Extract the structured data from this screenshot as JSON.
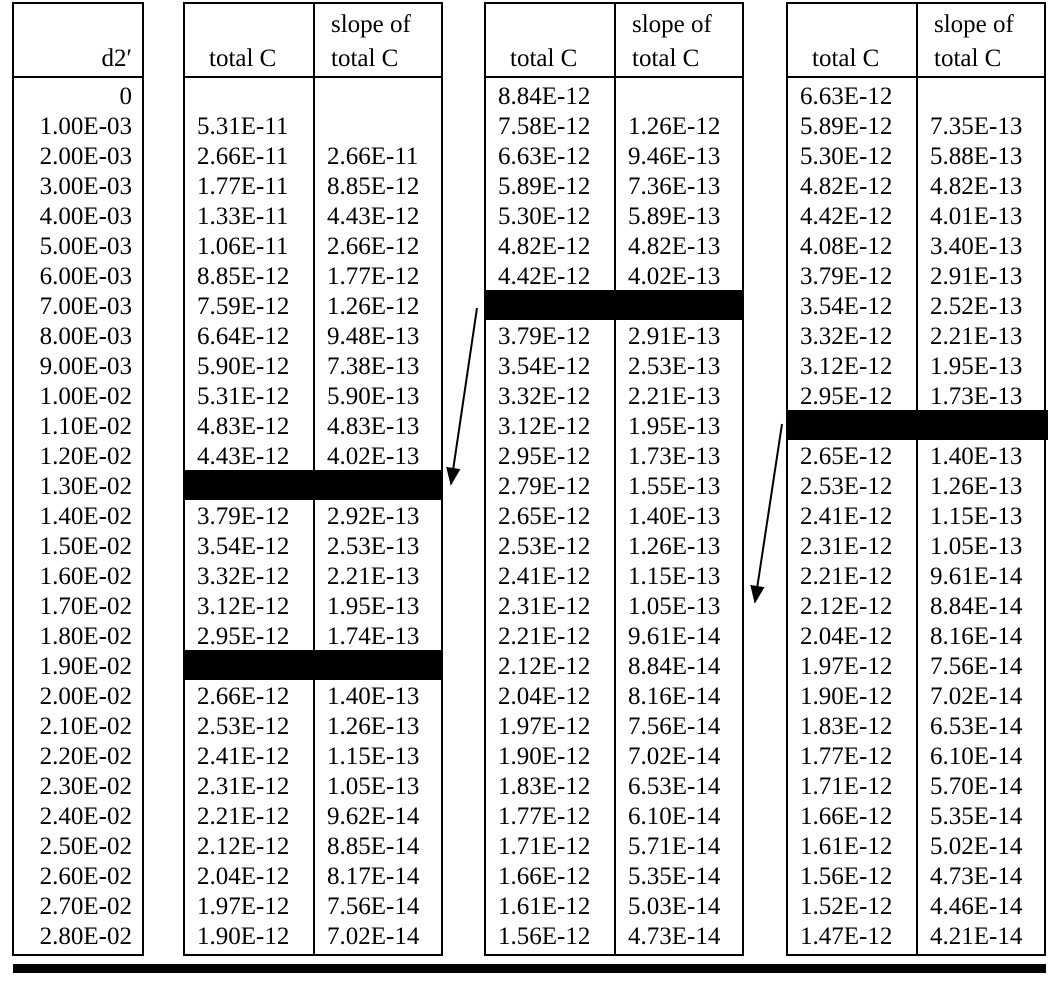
{
  "tables": [
    {
      "id": "d2",
      "headers": [
        {
          "line1": "",
          "line2": "d2′"
        }
      ],
      "rows": [
        [
          "0"
        ],
        [
          "1.00E-03"
        ],
        [
          "2.00E-03"
        ],
        [
          "3.00E-03"
        ],
        [
          "4.00E-03"
        ],
        [
          "5.00E-03"
        ],
        [
          "6.00E-03"
        ],
        [
          "7.00E-03"
        ],
        [
          "8.00E-03"
        ],
        [
          "9.00E-03"
        ],
        [
          "1.00E-02"
        ],
        [
          "1.10E-02"
        ],
        [
          "1.20E-02"
        ],
        [
          "1.30E-02"
        ],
        [
          "1.40E-02"
        ],
        [
          "1.50E-02"
        ],
        [
          "1.60E-02"
        ],
        [
          "1.70E-02"
        ],
        [
          "1.80E-02"
        ],
        [
          "1.90E-02"
        ],
        [
          "2.00E-02"
        ],
        [
          "2.10E-02"
        ],
        [
          "2.20E-02"
        ],
        [
          "2.30E-02"
        ],
        [
          "2.40E-02"
        ],
        [
          "2.50E-02"
        ],
        [
          "2.60E-02"
        ],
        [
          "2.70E-02"
        ],
        [
          "2.80E-02"
        ]
      ]
    },
    {
      "id": "set1",
      "headers": [
        {
          "line1": "",
          "line2": "total C"
        },
        {
          "line1": "slope of",
          "line2": "total C"
        }
      ],
      "rows": [
        [
          "",
          ""
        ],
        [
          "5.31E-11",
          ""
        ],
        [
          "2.66E-11",
          "2.66E-11"
        ],
        [
          "1.77E-11",
          "8.85E-12"
        ],
        [
          "1.33E-11",
          "4.43E-12"
        ],
        [
          "1.06E-11",
          "2.66E-12"
        ],
        [
          "8.85E-12",
          "1.77E-12"
        ],
        [
          "7.59E-12",
          "1.26E-12"
        ],
        [
          "6.64E-12",
          "9.48E-13"
        ],
        [
          "5.90E-12",
          "7.38E-13"
        ],
        [
          "5.31E-12",
          "5.90E-13"
        ],
        [
          "4.83E-12",
          "4.83E-13"
        ],
        [
          "4.43E-12",
          "4.02E-13"
        ],
        null,
        [
          "3.79E-12",
          "2.92E-13"
        ],
        [
          "3.54E-12",
          "2.53E-13"
        ],
        [
          "3.32E-12",
          "2.21E-13"
        ],
        [
          "3.12E-12",
          "1.95E-13"
        ],
        [
          "2.95E-12",
          "1.74E-13"
        ],
        null,
        [
          "2.66E-12",
          "1.40E-13"
        ],
        [
          "2.53E-12",
          "1.26E-13"
        ],
        [
          "2.41E-12",
          "1.15E-13"
        ],
        [
          "2.31E-12",
          "1.05E-13"
        ],
        [
          "2.21E-12",
          "9.62E-14"
        ],
        [
          "2.12E-12",
          "8.85E-14"
        ],
        [
          "2.04E-12",
          "8.17E-14"
        ],
        [
          "1.97E-12",
          "7.56E-14"
        ],
        [
          "1.90E-12",
          "7.02E-14"
        ]
      ]
    },
    {
      "id": "set2",
      "headers": [
        {
          "line1": "",
          "line2": "total C"
        },
        {
          "line1": "slope of",
          "line2": "total C"
        }
      ],
      "rows": [
        [
          "8.84E-12",
          ""
        ],
        [
          "7.58E-12",
          "1.26E-12"
        ],
        [
          "6.63E-12",
          "9.46E-13"
        ],
        [
          "5.89E-12",
          "7.36E-13"
        ],
        [
          "5.30E-12",
          "5.89E-13"
        ],
        [
          "4.82E-12",
          "4.82E-13"
        ],
        [
          "4.42E-12",
          "4.02E-13"
        ],
        null,
        [
          "3.79E-12",
          "2.91E-13"
        ],
        [
          "3.54E-12",
          "2.53E-13"
        ],
        [
          "3.32E-12",
          "2.21E-13"
        ],
        [
          "3.12E-12",
          "1.95E-13"
        ],
        [
          "2.95E-12",
          "1.73E-13"
        ],
        [
          "2.79E-12",
          "1.55E-13"
        ],
        [
          "2.65E-12",
          "1.40E-13"
        ],
        [
          "2.53E-12",
          "1.26E-13"
        ],
        [
          "2.41E-12",
          "1.15E-13"
        ],
        [
          "2.31E-12",
          "1.05E-13"
        ],
        [
          "2.21E-12",
          "9.61E-14"
        ],
        [
          "2.12E-12",
          "8.84E-14"
        ],
        [
          "2.04E-12",
          "8.16E-14"
        ],
        [
          "1.97E-12",
          "7.56E-14"
        ],
        [
          "1.90E-12",
          "7.02E-14"
        ],
        [
          "1.83E-12",
          "6.53E-14"
        ],
        [
          "1.77E-12",
          "6.10E-14"
        ],
        [
          "1.71E-12",
          "5.71E-14"
        ],
        [
          "1.66E-12",
          "5.35E-14"
        ],
        [
          "1.61E-12",
          "5.03E-14"
        ],
        [
          "1.56E-12",
          "4.73E-14"
        ]
      ]
    },
    {
      "id": "set3",
      "headers": [
        {
          "line1": "",
          "line2": "total C"
        },
        {
          "line1": "slope of",
          "line2": "total C"
        }
      ],
      "rows": [
        [
          "6.63E-12",
          ""
        ],
        [
          "5.89E-12",
          "7.35E-13"
        ],
        [
          "5.30E-12",
          "5.88E-13"
        ],
        [
          "4.82E-12",
          "4.82E-13"
        ],
        [
          "4.42E-12",
          "4.01E-13"
        ],
        [
          "4.08E-12",
          "3.40E-13"
        ],
        [
          "3.79E-12",
          "2.91E-13"
        ],
        [
          "3.54E-12",
          "2.52E-13"
        ],
        [
          "3.32E-12",
          "2.21E-13"
        ],
        [
          "3.12E-12",
          "1.95E-13"
        ],
        [
          "2.95E-12",
          "1.73E-13"
        ],
        null,
        [
          "2.65E-12",
          "1.40E-13"
        ],
        [
          "2.53E-12",
          "1.26E-13"
        ],
        [
          "2.41E-12",
          "1.15E-13"
        ],
        [
          "2.31E-12",
          "1.05E-13"
        ],
        [
          "2.21E-12",
          "9.61E-14"
        ],
        [
          "2.12E-12",
          "8.84E-14"
        ],
        [
          "2.04E-12",
          "8.16E-14"
        ],
        [
          "1.97E-12",
          "7.56E-14"
        ],
        [
          "1.90E-12",
          "7.02E-14"
        ],
        [
          "1.83E-12",
          "6.53E-14"
        ],
        [
          "1.77E-12",
          "6.10E-14"
        ],
        [
          "1.71E-12",
          "5.70E-14"
        ],
        [
          "1.66E-12",
          "5.35E-14"
        ],
        [
          "1.61E-12",
          "5.02E-14"
        ],
        [
          "1.56E-12",
          "4.73E-14"
        ],
        [
          "1.52E-12",
          "4.46E-14"
        ],
        [
          "1.47E-12",
          "4.21E-14"
        ]
      ]
    }
  ],
  "notes": {
    "blacked_out_rows": "null entries denote rows drawn as solid black bars",
    "arrows": [
      "set1 bar → set2 (pointing down-left)",
      "set2 bar → set3 (pointing down-left)"
    ]
  }
}
